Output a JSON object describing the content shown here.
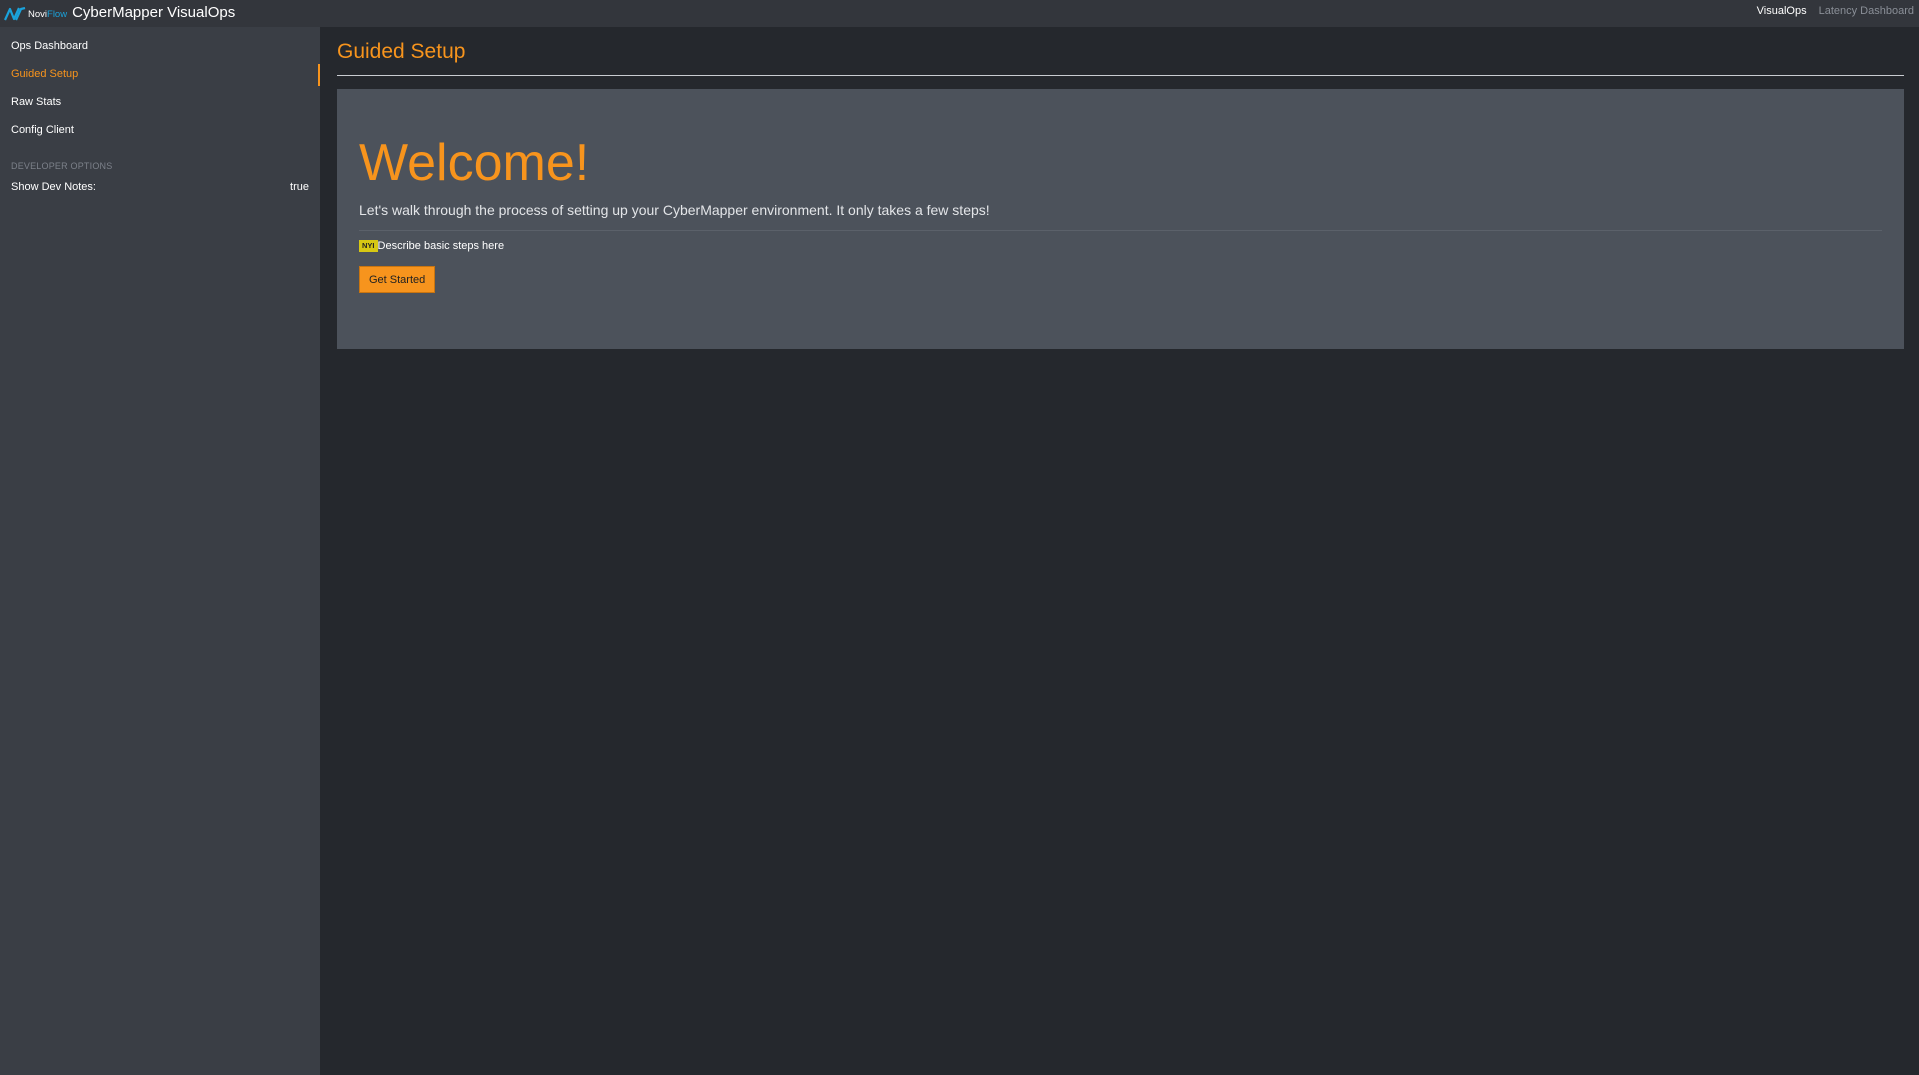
{
  "topbar": {
    "logo": {
      "icon": "noviflow-logo-icon",
      "novi": "Novi",
      "flow": "Flow",
      "accent_color": "#1aa3dc"
    },
    "app_title": "CyberMapper VisualOps",
    "links": [
      {
        "label": "VisualOps",
        "active": true
      },
      {
        "label": "Latency Dashboard",
        "active": false
      }
    ]
  },
  "sidebar": {
    "items": [
      {
        "label": "Ops Dashboard",
        "active": false
      },
      {
        "label": "Guided Setup",
        "active": true
      },
      {
        "label": "Raw Stats",
        "active": false
      },
      {
        "label": "Config Client",
        "active": false
      }
    ],
    "developer_options": {
      "header": "DEVELOPER OPTIONS",
      "show_dev_notes_label": "Show Dev Notes:",
      "show_dev_notes_value": "true"
    }
  },
  "main": {
    "page_title": "Guided Setup",
    "welcome": {
      "heading": "Welcome!",
      "lead": "Let's walk through the process of setting up your CyberMapper environment. It only takes a few steps!",
      "nyi_badge": "NYI",
      "nyi_note": "Describe basic steps here",
      "button_label": "Get Started"
    }
  },
  "colors": {
    "accent": "#f7941d",
    "topbar_bg": "#33363c",
    "sidebar_bg": "#3a3e45",
    "content_bg": "#25282d",
    "panel_bg": "#4c525b",
    "nyi_badge": "#d7c813"
  }
}
